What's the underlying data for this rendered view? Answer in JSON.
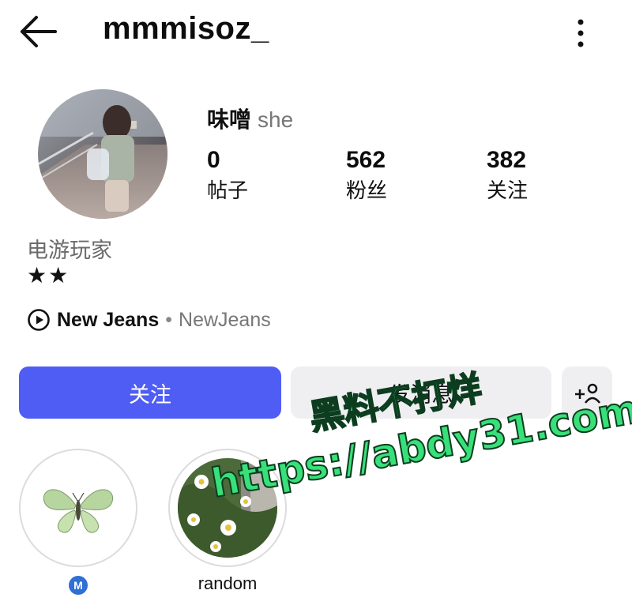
{
  "header": {
    "username": "mmmisoz_",
    "back_icon": "arrow-left-icon",
    "more_icon": "more-vertical-icon"
  },
  "profile": {
    "display_name": "味噌",
    "pronouns": "she",
    "avatar": "profile-photo",
    "stats": {
      "posts_count": "0",
      "posts_label": "帖子",
      "followers_count": "562",
      "followers_label": "粉丝",
      "following_count": "382",
      "following_label": "关注"
    },
    "category": "电游玩家",
    "bio": "★★",
    "music": {
      "icon": "play-circle-icon",
      "song": "New Jeans",
      "separator": "•",
      "artist": "NewJeans"
    }
  },
  "actions": {
    "follow_label": "关注",
    "message_label": "发消息",
    "suggest_icon": "add-person-icon"
  },
  "highlights": [
    {
      "label": "",
      "badge": "M",
      "image": "butterfly"
    },
    {
      "label": "random",
      "image": "daisies"
    }
  ],
  "watermark": {
    "line1": "黑料不打烊",
    "line2": "https://abdy31.com"
  },
  "colors": {
    "accent": "#4f5df5",
    "secondary_button": "#efeff1",
    "watermark": "#38e07a",
    "badge": "#2f6fd6"
  }
}
